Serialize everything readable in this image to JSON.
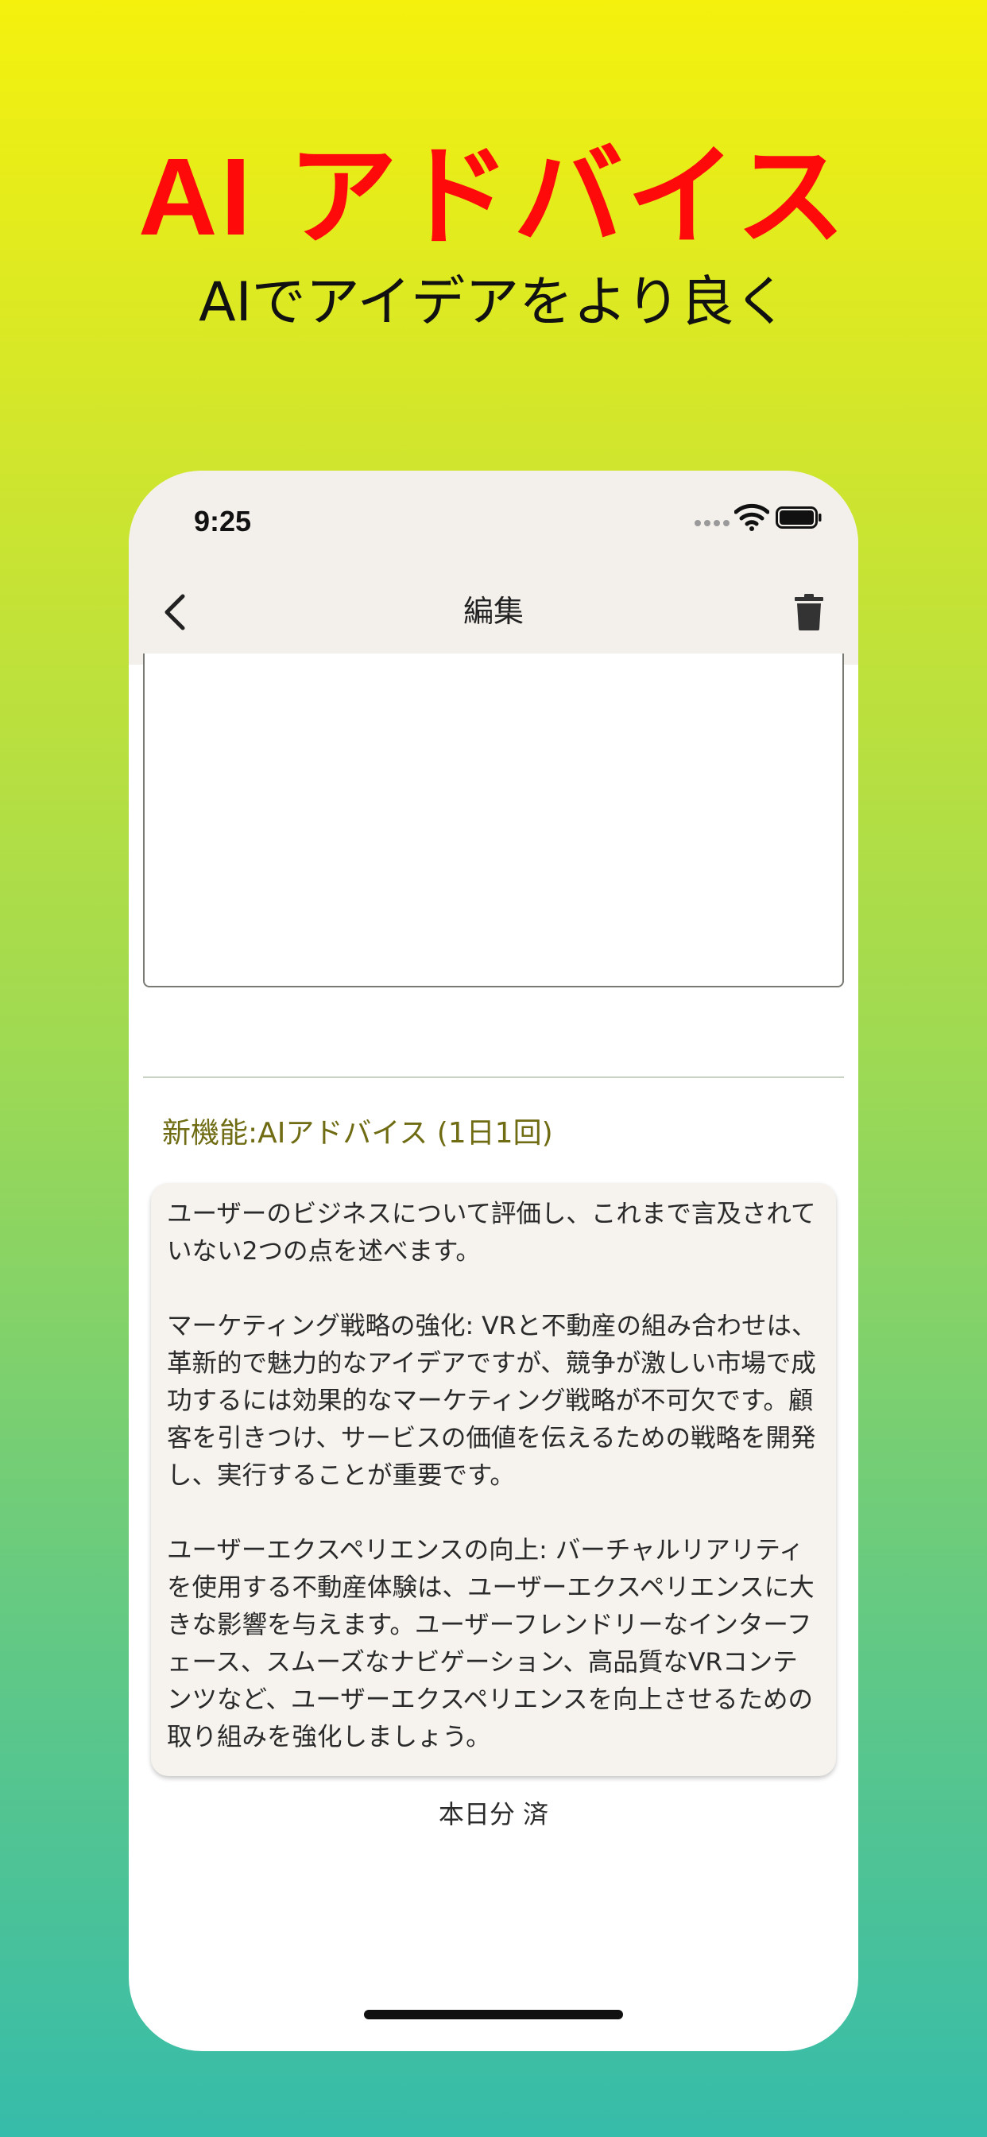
{
  "promo": {
    "title": "AI アドバイス",
    "subtitle": "AIでアイデアをより良く"
  },
  "status_bar": {
    "time": "9:25",
    "icons": [
      "signal-dots-icon",
      "wifi-icon",
      "battery-icon"
    ]
  },
  "nav": {
    "title": "編集",
    "back_icon": "chevron-left-icon",
    "delete_icon": "trash-icon"
  },
  "memo": {
    "value": ""
  },
  "ai_advice": {
    "heading": "新機能:AIアドバイス (1日1回)",
    "paragraphs": [
      "ユーザーのビジネスについて評価し、これまで言及されていない2つの点を述べます。",
      "マーケティング戦略の強化: VRと不動産の組み合わせは、革新的で魅力的なアイデアですが、競争が激しい市場で成功するには効果的なマーケティング戦略が不可欠です。顧客を引きつけ、サービスの価値を伝えるための戦略を開発し、実行することが重要です。",
      "ユーザーエクスペリエンスの向上: バーチャルリアリティを使用する不動産体験は、ユーザーエクスペリエンスに大きな影響を与えます。ユーザーフレンドリーなインターフェース、スムーズなナビゲーション、高品質なVRコンテンツなど、ユーザーエクスペリエンスを向上させるための取り組みを強化しましょう。"
    ],
    "status": "本日分 済"
  },
  "colors": {
    "title_red": "#ff0a0a",
    "gradient_top": "#f5f10d",
    "gradient_bottom": "#36bcaa",
    "header_bg": "#f3f0eb",
    "heading_olive": "#6f6c14",
    "card_bg": "#f6f3ef"
  }
}
